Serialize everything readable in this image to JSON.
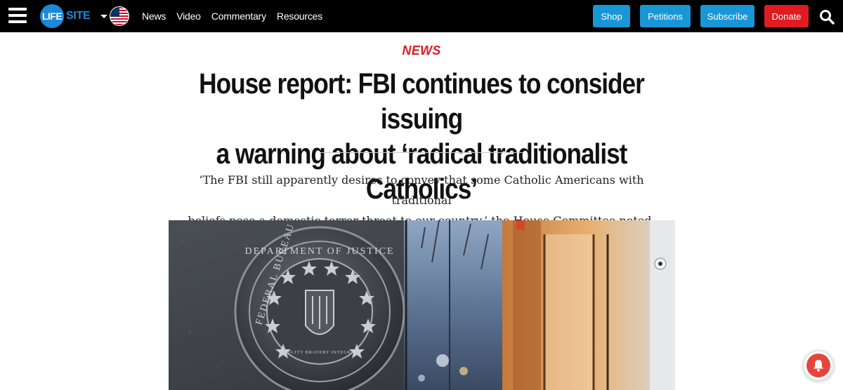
{
  "nav": {
    "logo_mark": "LIFE",
    "logo_text": "SITE",
    "links": [
      "News",
      "Video",
      "Commentary",
      "Resources"
    ],
    "buttons": {
      "shop": "Shop",
      "petitions": "Petitions",
      "subscribe": "Subscribe",
      "donate": "Donate"
    }
  },
  "article": {
    "section": "NEWS",
    "headline_line1": "House report: FBI continues to consider issuing",
    "headline_line2": "a warning about ‘radical traditionalist Catholics’",
    "dek_line1": "‘The FBI still apparently desires to convey that some Catholic Americans with traditional",
    "dek_line2": "beliefs pose a domestic terror threat to our country,’ the House Committee noted.",
    "seal_top_text": "DEPARTMENT OF JUSTICE",
    "seal_left_text": "FEDERAL BUREAU OF INVESTIGATION",
    "seal_motto": "FIDELITY BRAVERY INTEGRITY"
  },
  "colors": {
    "nav_bg": "#000000",
    "brand_blue": "#1996d6",
    "donate_red": "#e01b22",
    "section_red": "#e01b22"
  },
  "icons": [
    "menu-icon",
    "chevron-down-icon",
    "us-flag-icon",
    "search-icon",
    "bell-icon"
  ]
}
